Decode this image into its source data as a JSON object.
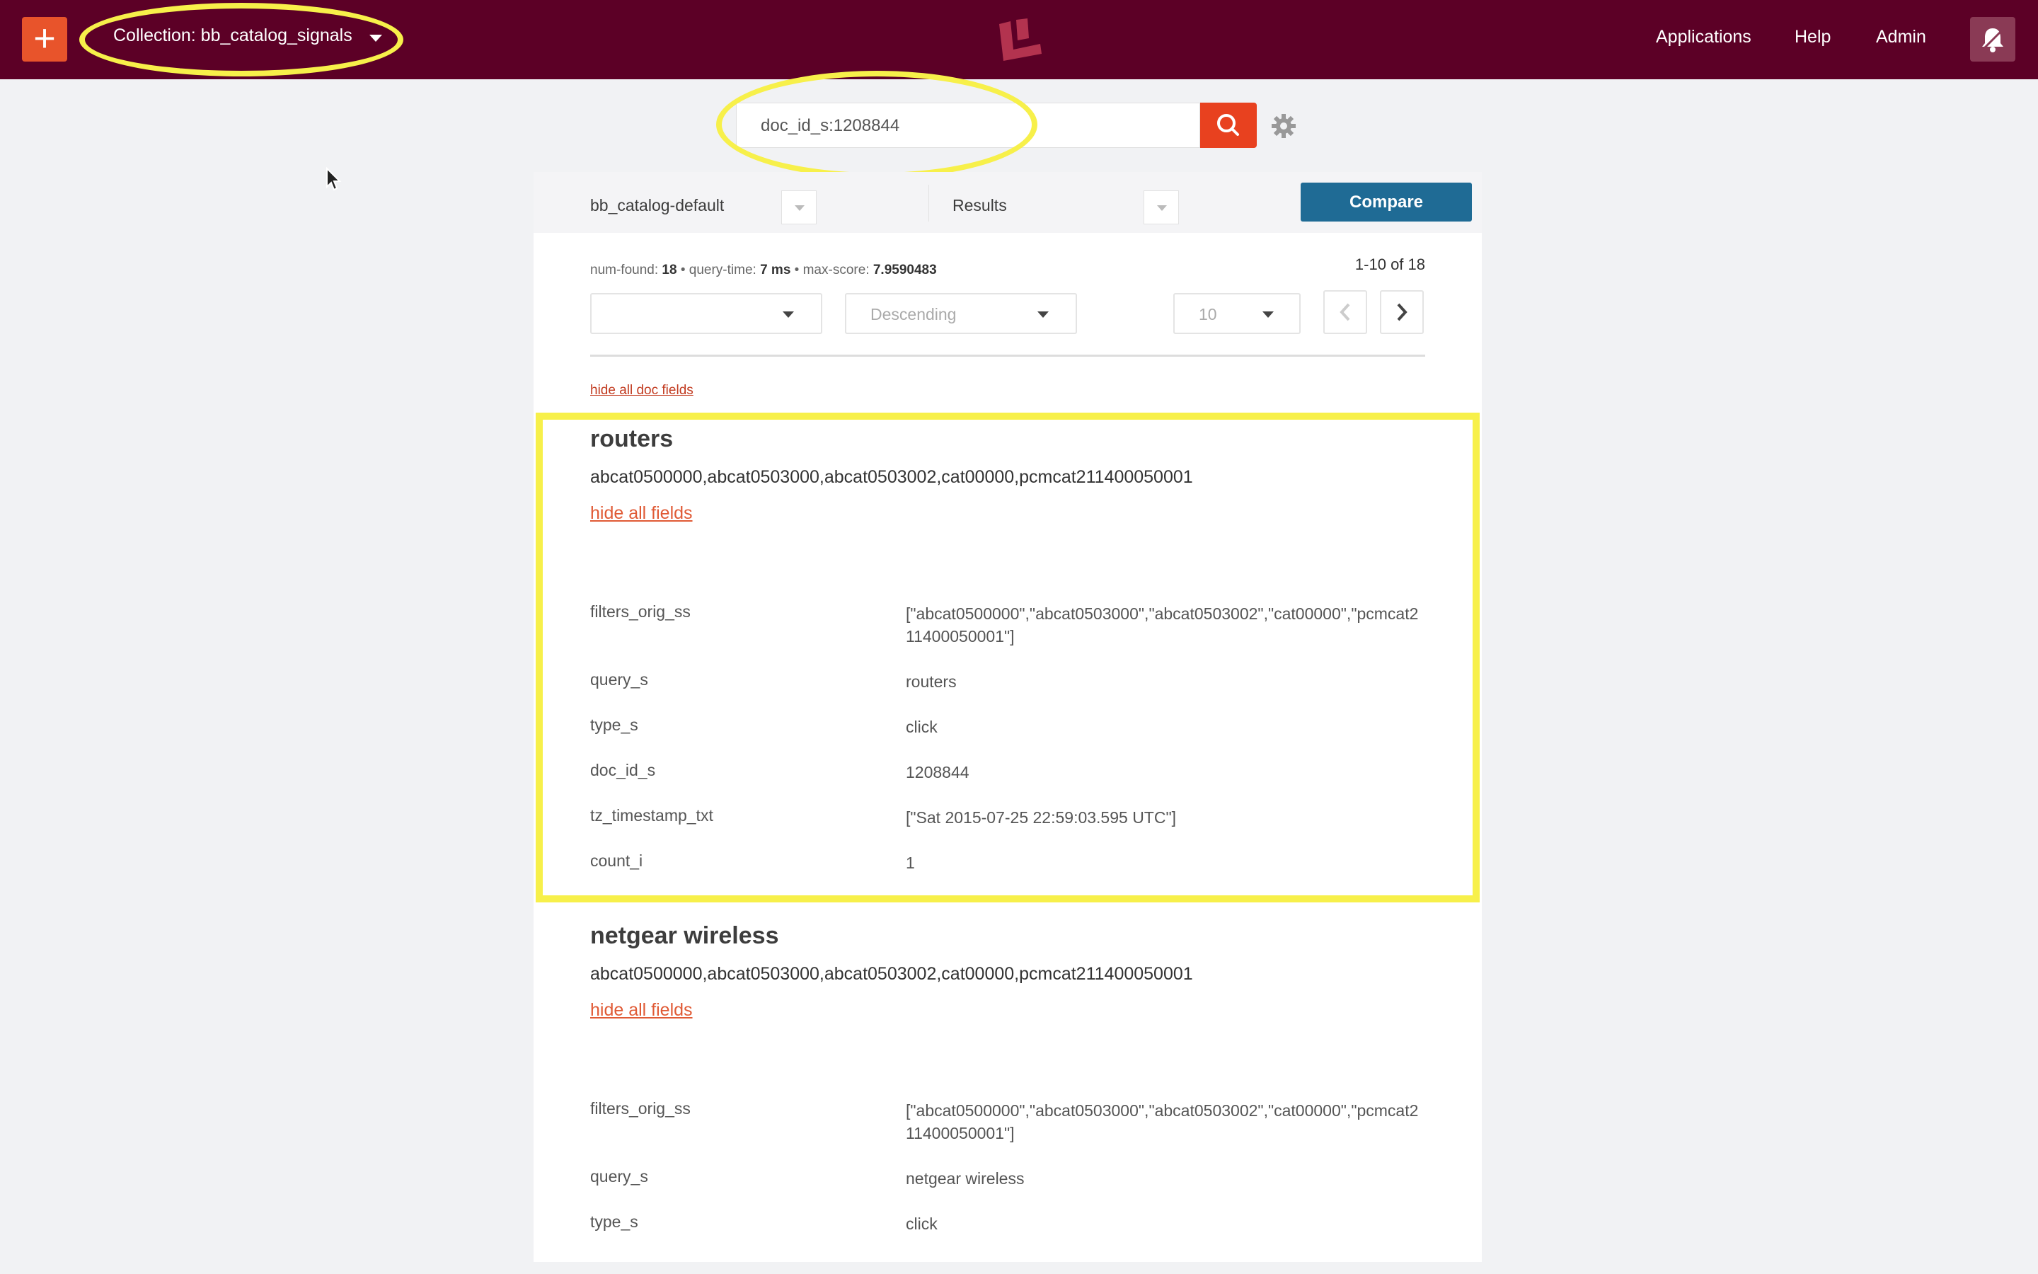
{
  "header": {
    "add_label": "+",
    "collection_label": "Collection: bb_catalog_signals",
    "nav": [
      "Applications",
      "Help",
      "Admin"
    ],
    "accent_color": "#e8542b",
    "bar_color": "#5c0026"
  },
  "search": {
    "value": "doc_id_s:1208844",
    "placeholder": ""
  },
  "panel": {
    "pipeline_label": "bb_catalog-default",
    "results_label": "Results",
    "compare_label": "Compare",
    "stats": {
      "num_found_label": "num-found:",
      "num_found": "18",
      "query_time_label": "query-time:",
      "query_time": "7 ms",
      "max_score_label": "max-score:",
      "max_score": "7.9590483",
      "sep": "•"
    },
    "range": "1-10 of 18",
    "sort_field": "",
    "sort_order": "Descending",
    "page_size": "10",
    "hide_doc_fields": "hide all doc fields"
  },
  "results": [
    {
      "title": "routers",
      "categories": "abcat0500000,abcat0503000,abcat0503002,cat00000,pcmcat211400050001",
      "hide_label": "hide all fields",
      "fields": [
        {
          "key": "filters_orig_ss",
          "value": "[\"abcat0500000\",\"abcat0503000\",\"abcat0503002\",\"cat00000\",\"pcmcat211400050001\"]"
        },
        {
          "key": "query_s",
          "value": "routers"
        },
        {
          "key": "type_s",
          "value": "click"
        },
        {
          "key": "doc_id_s",
          "value": "1208844"
        },
        {
          "key": "tz_timestamp_txt",
          "value": "[\"Sat 2015-07-25 22:59:03.595 UTC\"]"
        },
        {
          "key": "count_i",
          "value": "1"
        }
      ]
    },
    {
      "title": "netgear wireless",
      "categories": "abcat0500000,abcat0503000,abcat0503002,cat00000,pcmcat211400050001",
      "hide_label": "hide all fields",
      "fields": [
        {
          "key": "filters_orig_ss",
          "value": "[\"abcat0500000\",\"abcat0503000\",\"abcat0503002\",\"cat00000\",\"pcmcat211400050001\"]"
        },
        {
          "key": "query_s",
          "value": "netgear wireless"
        },
        {
          "key": "type_s",
          "value": "click"
        }
      ]
    }
  ]
}
